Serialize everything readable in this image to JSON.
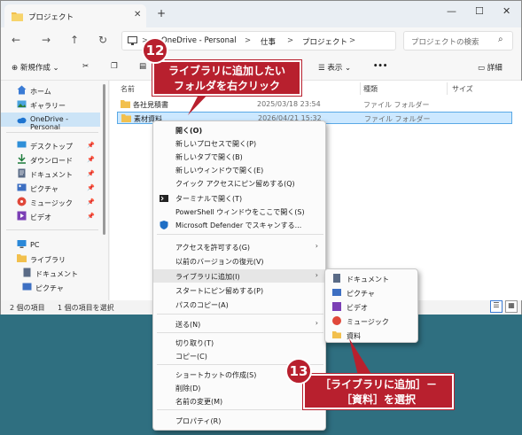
{
  "window": {
    "tab_title": "プロジェクト",
    "tab_close": "✕",
    "new_tab": "+",
    "controls": {
      "minimize": "—",
      "maximize": "☐",
      "close": "✕"
    }
  },
  "nav": {
    "back": "←",
    "forward": "→",
    "up": "↑",
    "refresh": "↻",
    "breadcrumb": [
      "OneDrive - Personal",
      "仕事",
      "プロジェクト"
    ],
    "separator": ">",
    "search_placeholder": "プロジェクトの検索"
  },
  "toolbar": {
    "new_label": "新規作成",
    "view_label": "表示",
    "more_label": "•••",
    "details_label": "詳細"
  },
  "sidebar": {
    "items": [
      {
        "label": "ホーム",
        "icon": "home-icon"
      },
      {
        "label": "ギャラリー",
        "icon": "gallery-icon"
      },
      {
        "label": "OneDrive - Personal",
        "icon": "cloud-icon"
      },
      {
        "label": "デスクトップ",
        "icon": "desktop-icon"
      },
      {
        "label": "ダウンロード",
        "icon": "download-icon"
      },
      {
        "label": "ドキュメント",
        "icon": "document-icon"
      },
      {
        "label": "ピクチャ",
        "icon": "picture-icon"
      },
      {
        "label": "ミュージック",
        "icon": "music-icon"
      },
      {
        "label": "ビデオ",
        "icon": "video-icon"
      },
      {
        "label": "PC",
        "icon": "pc-icon"
      },
      {
        "label": "ライブラリ",
        "icon": "library-icon"
      },
      {
        "label": "ドキュメント",
        "icon": "document-icon"
      },
      {
        "label": "ピクチャ",
        "icon": "picture-icon"
      }
    ],
    "pin_glyph": "📌"
  },
  "columns": {
    "name": "名前",
    "type": "種類",
    "size": "サイズ"
  },
  "files": [
    {
      "name": "各社見積書",
      "date": "2025/03/18 23:54",
      "type": "ファイル フォルダー"
    },
    {
      "name": "素材資料",
      "date": "2026/04/21 15:32",
      "type": "ファイル フォルダー"
    }
  ],
  "status": {
    "count": "2 個の項目",
    "selected": "1 個の項目を選択"
  },
  "context_menu": {
    "items": [
      {
        "label": "開く(O)"
      },
      {
        "label": "新しいプロセスで開く(P)"
      },
      {
        "label": "新しいタブで開く(B)"
      },
      {
        "label": "新しいウィンドウで開く(E)"
      },
      {
        "label": "クイック アクセスにピン留めする(Q)"
      },
      {
        "label": "ターミナルで開く(T)"
      },
      {
        "label": "PowerShell ウィンドウをここで開く(S)"
      },
      {
        "label": "Microsoft Defender でスキャンする..."
      },
      {
        "label": "アクセスを許可する(G)"
      },
      {
        "label": "以前のバージョンの復元(V)"
      },
      {
        "label": "ライブラリに追加(I)"
      },
      {
        "label": "スタートにピン留めする(P)"
      },
      {
        "label": "パスのコピー(A)"
      },
      {
        "label": "送る(N)"
      },
      {
        "label": "切り取り(T)"
      },
      {
        "label": "コピー(C)"
      },
      {
        "label": "ショートカットの作成(S)"
      },
      {
        "label": "削除(D)"
      },
      {
        "label": "名前の変更(M)"
      },
      {
        "label": "プロパティ(R)"
      }
    ],
    "arrow": "›"
  },
  "submenu": {
    "items": [
      {
        "label": "ドキュメント"
      },
      {
        "label": "ピクチャ"
      },
      {
        "label": "ビデオ"
      },
      {
        "label": "ミュージック"
      },
      {
        "label": "資料"
      }
    ]
  },
  "callouts": {
    "step1_number": "12",
    "step1_text_line1": "ライブラリに追加したい",
    "step1_text_line2": "フォルダを右クリック",
    "step2_number": "13",
    "step2_text_line1": "［ライブラリに追加］－",
    "step2_text_line2": "［資料］を選択"
  },
  "colors": {
    "accent": "#b8202e",
    "selection": "#cce8ff",
    "desktop": "#2f6f80"
  }
}
